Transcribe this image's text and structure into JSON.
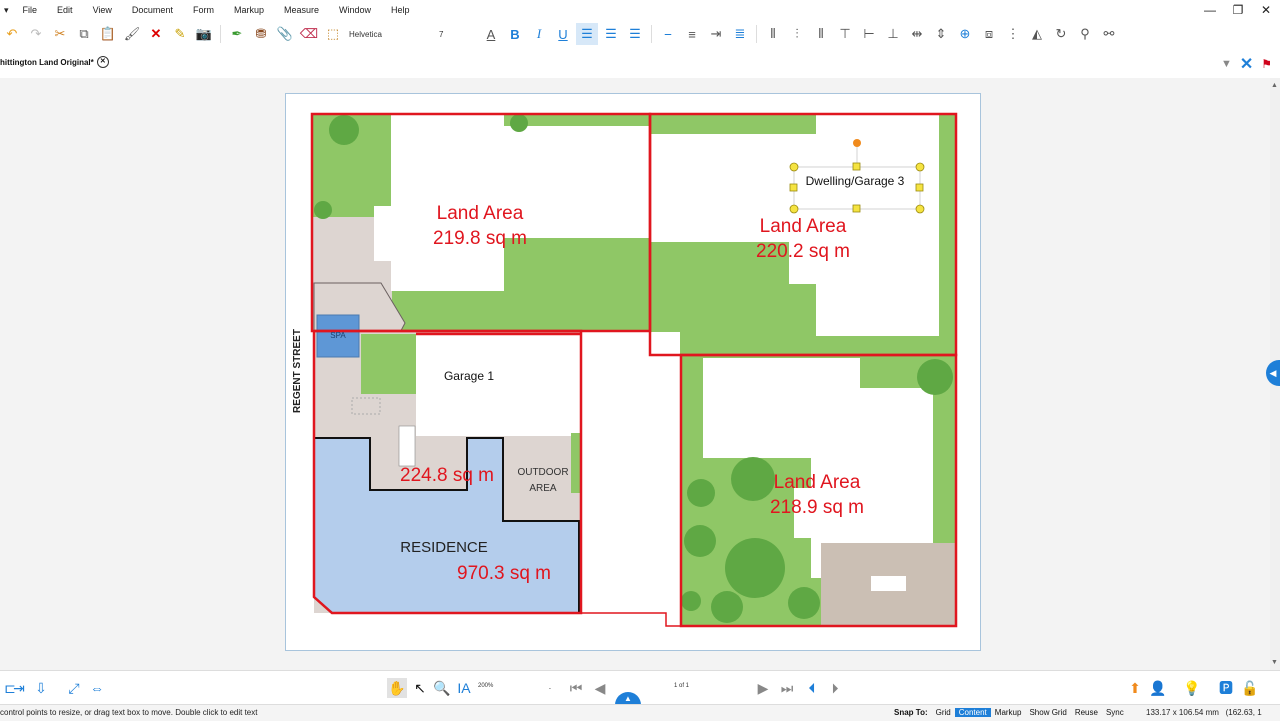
{
  "menu": [
    "File",
    "Edit",
    "View",
    "Document",
    "Form",
    "Markup",
    "Measure",
    "Window",
    "Help"
  ],
  "toolbar": {
    "font_name": "Helvetica",
    "font_size": "7"
  },
  "tab": {
    "title": "hittington Land Original*"
  },
  "plan": {
    "street_label": "REGENT STREET",
    "spa_label": "SPA",
    "residence_label": "RESIDENCE",
    "outdoor_label_1": "OUTDOOR",
    "outdoor_label_2": "AREA",
    "garage1_label": "Garage 1",
    "dwelling_label": "Dwelling/Garage 3",
    "area_top_left_title": "Land Area",
    "area_top_left_value": "219.8 sq m",
    "area_top_right_title": "Land Area",
    "area_top_right_value": "220.2 sq m",
    "area_bottom_right_title": "Land Area",
    "area_bottom_right_value": "218.9 sq m",
    "area_garage_value": "224.8 sq m",
    "area_residence_value": "970.3 sq m"
  },
  "statusbar": {
    "zoom": "200%",
    "page": "1 of 1"
  },
  "bottom": {
    "hint": "control points to resize, or drag text box to move. Double click to edit text",
    "snap_to": "Snap To:",
    "snap_items": [
      "Grid",
      "Content",
      "Markup",
      "Show Grid",
      "Reuse",
      "Sync"
    ],
    "dims": "133.17 x 106.54 mm",
    "coords": "(162.63, 1"
  },
  "colors": {
    "accent": "#1e7fd8",
    "markup_red": "#e0161f",
    "lawn": "#8fc766",
    "paving": "#ddd5d1",
    "residence": "#b4cdec",
    "spa": "#5e97d6"
  }
}
